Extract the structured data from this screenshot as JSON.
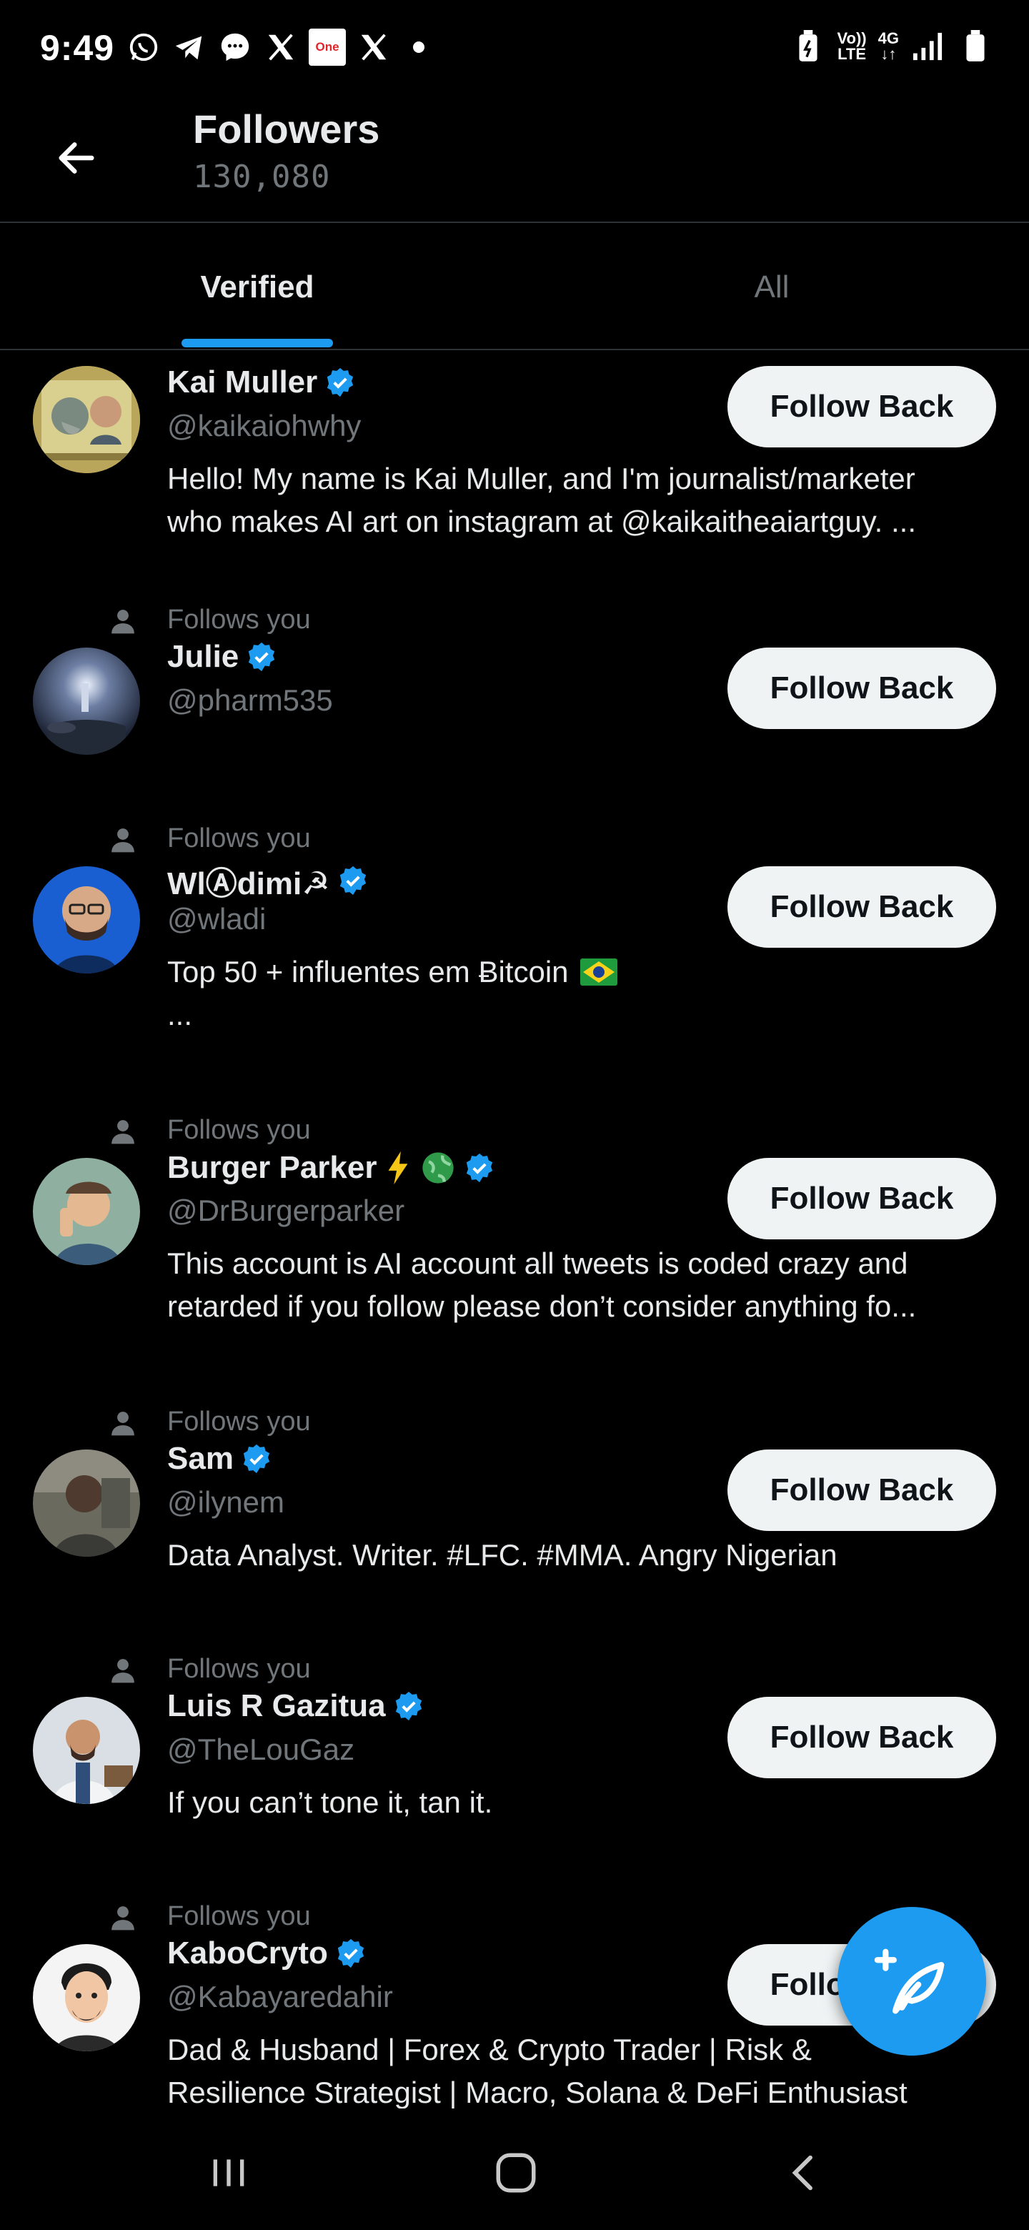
{
  "status_bar": {
    "time": "9:49",
    "one_label": "One",
    "volte_top": "Vo))",
    "volte_bottom": "LTE",
    "network": "4G",
    "left_icons": [
      "whatsapp-icon",
      "telegram-icon",
      "messenger-icon",
      "x-icon",
      "one-app-icon",
      "x-icon",
      "notification-dot"
    ],
    "right_icons": [
      "battery-saver-icon",
      "volte-icon",
      "4g-icon",
      "signal-icon",
      "battery-icon"
    ]
  },
  "header": {
    "title": "Followers",
    "count": "130,080"
  },
  "tabs": [
    {
      "label": "Verified",
      "active": true
    },
    {
      "label": "All",
      "active": false
    }
  ],
  "colors": {
    "accent": "#1d9bf0",
    "background": "#000000",
    "muted": "#71767b",
    "divider": "#2f3336",
    "button_bg": "#eff3f4"
  },
  "followers": [
    {
      "name": "Kai Muller",
      "handle": "@kaikaiohwhy",
      "bio_line1": "Hello! My name is Kai Muller, and I'm journalist/marketer",
      "bio_line2": "who makes AI art on instagram at @kaikaitheaiartguy. ...",
      "follows_you": "",
      "button": "Follow Back",
      "verified": true
    },
    {
      "name": "Julie",
      "handle": "@pharm535",
      "bio_line1": "",
      "bio_line2": "",
      "follows_you": "Follows you",
      "button": "Follow Back",
      "verified": true
    },
    {
      "name": "WlⒶdimi☭",
      "handle": "@wladi",
      "bio_line1": "Top 50 + influentes em Ƀitcoin",
      "bio_line2": "...",
      "follows_you": "Follows you",
      "button": "Follow Back",
      "verified": true,
      "flag": "brazil-flag-icon"
    },
    {
      "name": "Burger Parker",
      "handle": "@DrBurgerparker",
      "bio_line1": "This account is AI account all tweets is coded crazy and",
      "bio_line2": "retarded if you follow please don’t consider anything fo...",
      "follows_you": "Follows you",
      "button": "Follow Back",
      "verified": true,
      "name_emojis": [
        "lightning-icon",
        "globe-icon"
      ]
    },
    {
      "name": "Sam",
      "handle": "@ilynem",
      "bio_line1": "Data Analyst. Writer. #LFC. #MMA. Angry Nigerian",
      "bio_line2": "",
      "follows_you": "Follows you",
      "button": "Follow Back",
      "verified": true
    },
    {
      "name": "Luis R Gazitua",
      "handle": "@TheLouGaz",
      "bio_line1": "If you can’t tone it, tan it.",
      "bio_line2": "",
      "follows_you": "Follows you",
      "button": "Follow Back",
      "verified": true
    },
    {
      "name": "KaboCryto",
      "handle": "@Kabayaredahir",
      "bio_line1": "Dad & Husband | Forex & Crypto Trader | Risk &",
      "bio_line2": "Resilience Strategist | Macro, Solana & DeFi Enthusiast",
      "follows_you": "Follows you",
      "button": "Follow Back",
      "verified": true
    }
  ],
  "fab": {
    "icon": "compose-post-icon"
  },
  "nav_bar": {
    "icons": [
      "recent-apps-icon",
      "home-icon",
      "back-icon"
    ]
  }
}
